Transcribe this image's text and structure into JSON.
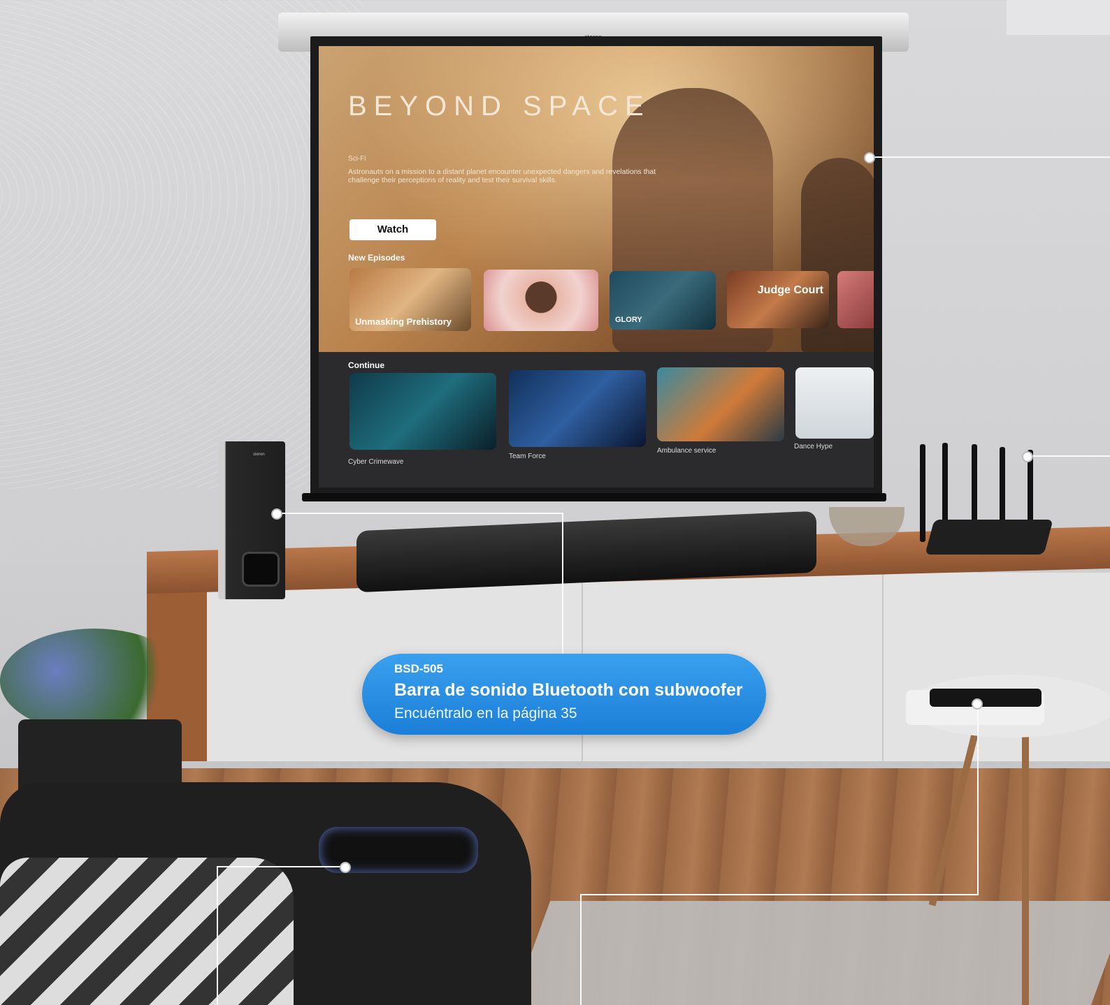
{
  "screen": {
    "brand_logo": "steren",
    "hero": {
      "title": "BEYOND SPACE",
      "genre": "Sci-Fi",
      "synopsis": "Astronauts on a mission to a distant planet encounter unexpected dangers and revelations that challenge their perceptions of reality and test their survival skills.",
      "watch_label": "Watch"
    },
    "new_episodes": {
      "title": "New Episodes",
      "items": [
        {
          "caption": "Unmasking Prehistory"
        },
        {
          "caption": ""
        },
        {
          "caption": "GLORY"
        },
        {
          "caption": "Judge Court"
        },
        {
          "caption": ""
        }
      ]
    },
    "continue": {
      "title": "Continue",
      "items": [
        {
          "label": "Cyber Crimewave"
        },
        {
          "label": "Team Force"
        },
        {
          "label": "Ambulance service"
        },
        {
          "label": "Dance Hype"
        }
      ]
    }
  },
  "subwoofer_logo": "steren",
  "badge": {
    "model": "BSD-505",
    "title": "Barra de sonido Bluetooth con subwoofer",
    "subtitle": "Encuéntralo en la página 35",
    "color": "#1b7fd8"
  }
}
